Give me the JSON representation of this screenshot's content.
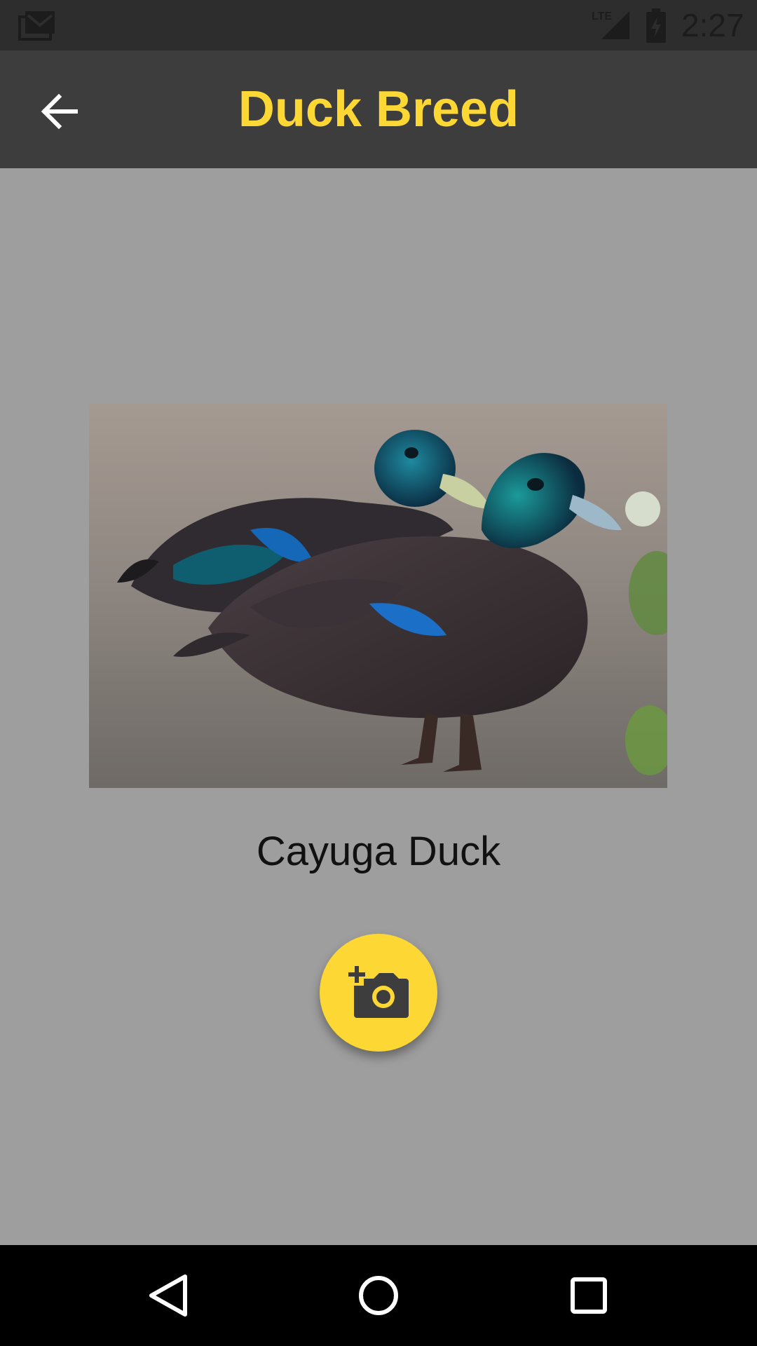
{
  "status_bar": {
    "time": "2:27",
    "network_label": "LTE",
    "icons": [
      "mail-icon",
      "lte-signal-icon",
      "battery-charging-icon"
    ]
  },
  "app_bar": {
    "title": "Duck Breed",
    "back_icon": "arrow-back-icon",
    "title_color": "#fdd835",
    "background": "#3d3d3d"
  },
  "main": {
    "breed_name": "Cayuga Duck",
    "image_subject": "two Cayuga ducks",
    "background": "#9e9e9e"
  },
  "fab": {
    "icon": "add-a-photo-icon",
    "color": "#fdd835"
  },
  "nav_bar": {
    "buttons": [
      "nav-back-icon",
      "nav-home-icon",
      "nav-recents-icon"
    ]
  }
}
